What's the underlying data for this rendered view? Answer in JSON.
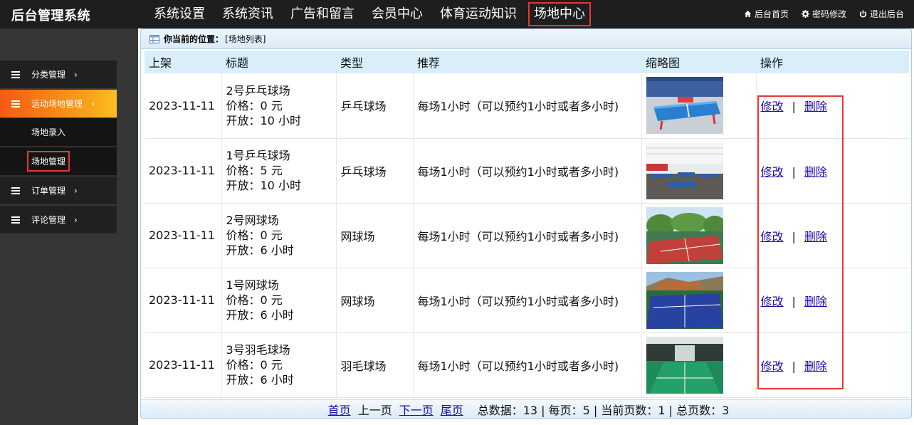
{
  "brand": "后台管理系统",
  "topnav": [
    "系统设置",
    "系统资讯",
    "广告和留言",
    "会员中心",
    "体育运动知识",
    "场地中心"
  ],
  "right_links": {
    "home": "后台首页",
    "password": "密码修改",
    "logout": "退出后台"
  },
  "sidebar": {
    "category": "分类管理",
    "venue": "运动场地管理",
    "venue_add": "场地录入",
    "venue_manage": "场地管理",
    "orders": "订单管理",
    "comments": "评论管理"
  },
  "breadcrumb": {
    "label": "你当前的位置：",
    "value": "[场地列表]"
  },
  "table": {
    "headers": [
      "上架",
      "标题",
      "类型",
      "推荐",
      "缩略图",
      "操作"
    ],
    "rows": [
      {
        "date": "2023-11-11",
        "name": "2号乒乓球场",
        "price": "价格：0 元",
        "open": "开放：10 小时",
        "type": "乒乓球场",
        "rec": "每场1小时（可以预约1小时或者多小时)"
      },
      {
        "date": "2023-11-11",
        "name": "1号乒乓球场",
        "price": "价格：5 元",
        "open": "开放：10 小时",
        "type": "乒乓球场",
        "rec": "每场1小时（可以预约1小时或者多小时)"
      },
      {
        "date": "2023-11-11",
        "name": "2号网球场",
        "price": "价格：0 元",
        "open": "开放：6 小时",
        "type": "网球场",
        "rec": "每场1小时（可以预约1小时或者多小时)"
      },
      {
        "date": "2023-11-11",
        "name": "1号网球场",
        "price": "价格：0 元",
        "open": "开放：6 小时",
        "type": "网球场",
        "rec": "每场1小时（可以预约1小时或者多小时)"
      },
      {
        "date": "2023-11-11",
        "name": "3号羽毛球场",
        "price": "价格：0 元",
        "open": "开放：6 小时",
        "type": "羽毛球场",
        "rec": "每场1小时（可以预约1小时或者多小时)"
      }
    ],
    "edit": "修改",
    "sep": "|",
    "del": "删除"
  },
  "pager": {
    "first": "首页",
    "prev": "上一页",
    "next": "下一页",
    "last": "尾页",
    "stats": "总数据：13 | 每页：5 | 当前页数：1 | 总页数：3"
  },
  "colors": {
    "accent_red": "#e53935",
    "active_gradient_start": "#f55a12",
    "active_gradient_end": "#fbbf20",
    "header_bg": "#1e1e1e"
  }
}
